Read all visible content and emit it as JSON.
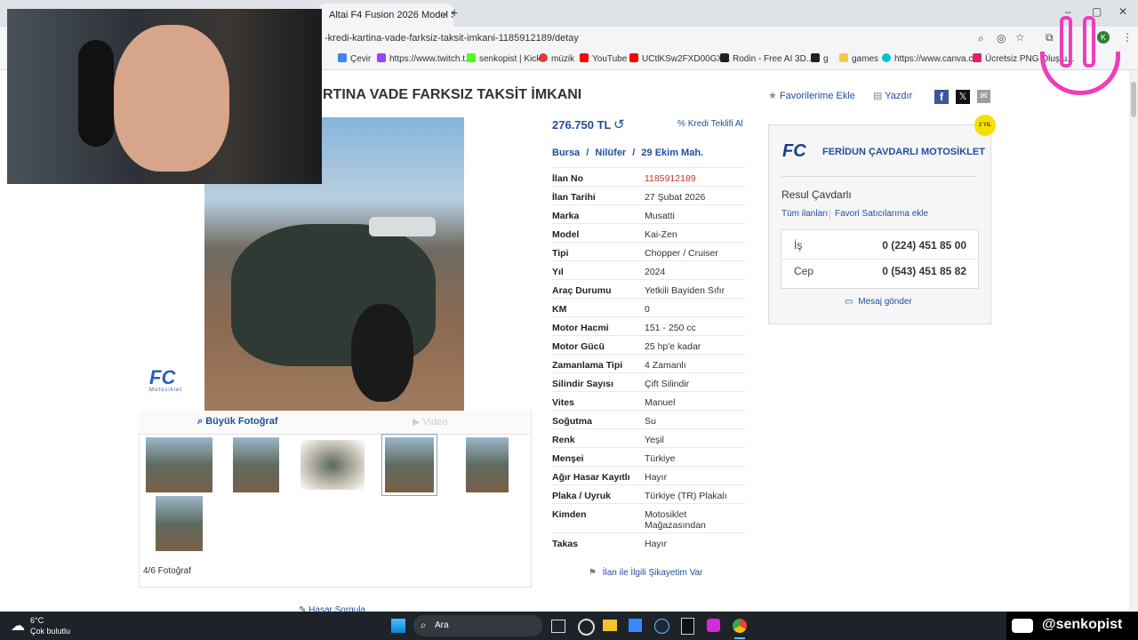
{
  "browser": {
    "tab_title": "Altai F4 Fusion 2026 Model Sc",
    "tab_close": "×",
    "new_tab": "+",
    "url": "-kredi-kartina-vade-farksiz-taksit-imkani-1185912189/detay",
    "bookmarks": [
      {
        "label": "Çevir",
        "color": "#4285f4"
      },
      {
        "label": "https://www.twitch.t...",
        "color": "#9146ff"
      },
      {
        "label": "senkopist | Kick",
        "color": "#53fc18"
      },
      {
        "label": "müzik",
        "color": "#e53935"
      },
      {
        "label": "YouTube",
        "color": "#ff0000"
      },
      {
        "label": "UCtlKSw2FXD00GX...",
        "color": "#ff0000"
      },
      {
        "label": "Rodin - Free AI 3D...",
        "color": "#222222"
      },
      {
        "label": "g",
        "color": "#222222"
      },
      {
        "label": "games",
        "color": "#f2c94c"
      },
      {
        "label": "https://www.canva.c...",
        "color": "#00c4cc"
      },
      {
        "label": "Ücretsiz PNG Oluştu...",
        "color": "#e91e63"
      }
    ],
    "profile_initial": "K"
  },
  "listing": {
    "title": "RTINA VADE FARKSIZ TAKSİT İMKANI",
    "favorites": "Favorilerime Ekle",
    "print": "Yazdır",
    "price": "276.750 TL",
    "credit": "Kredi Teklifi Al",
    "location": {
      "city": "Bursa",
      "sep1": "/",
      "district": "Nilüfer",
      "sep2": "/",
      "neighborhood": "29 Ekim Mah."
    },
    "details": [
      {
        "k": "İlan No",
        "v": "1185912189",
        "red": true
      },
      {
        "k": "İlan Tarihi",
        "v": "27 Şubat 2026"
      },
      {
        "k": "Marka",
        "v": "Musatti"
      },
      {
        "k": "Model",
        "v": "Kai-Zen"
      },
      {
        "k": "Tipi",
        "v": "Chopper / Cruiser"
      },
      {
        "k": "Yıl",
        "v": "2024"
      },
      {
        "k": "Araç Durumu",
        "v": "Yetkili Bayiden Sıfır"
      },
      {
        "k": "KM",
        "v": "0"
      },
      {
        "k": "Motor Hacmi",
        "v": "151 - 250 cc"
      },
      {
        "k": "Motor Gücü",
        "v": "25 hp'e kadar"
      },
      {
        "k": "Zamanlama Tipi",
        "v": "4 Zamanlı"
      },
      {
        "k": "Silindir Sayısı",
        "v": "Çift Silindir"
      },
      {
        "k": "Vites",
        "v": "Manuel"
      },
      {
        "k": "Soğutma",
        "v": "Su"
      },
      {
        "k": "Renk",
        "v": "Yeşil"
      },
      {
        "k": "Menşei",
        "v": "Türkiye"
      },
      {
        "k": "Ağır Hasar Kayıtlı",
        "v": "Hayır"
      },
      {
        "k": "Plaka / Uyruk",
        "v": "Türkiye (TR) Plakalı"
      },
      {
        "k": "Kimden",
        "v": "Motosiklet Mağazasından"
      },
      {
        "k": "Takas",
        "v": "Hayır"
      }
    ],
    "complaint": "İlan ile İlgili Şikayetim Var",
    "big_photo": "Büyük Fotoğraf",
    "video": "Video",
    "photo_counter": "4/6 Fotoğraf",
    "watermark": "FC",
    "watermark_sub": "Motosiklet",
    "damage_query": "Hasar Sorgula"
  },
  "seller": {
    "badge": "2 YIL",
    "logo": "FC",
    "store_name": "FERİDUN ÇAVDARLI MOTOSİKLET",
    "person": "Resul Çavdarlı",
    "all_listings": "Tüm ilanları",
    "fav_seller": "Favori Satıcılarıma ekle",
    "phones": [
      {
        "label": "İş",
        "number": "0 (224) 451 85 00"
      },
      {
        "label": "Cep",
        "number": "0 (543) 451 85 82"
      }
    ],
    "message": "Mesaj gönder"
  },
  "taskbar": {
    "temp": "6°C",
    "weather": "Çok bulutlu",
    "search": "Ara",
    "channel": "@senkopist"
  }
}
